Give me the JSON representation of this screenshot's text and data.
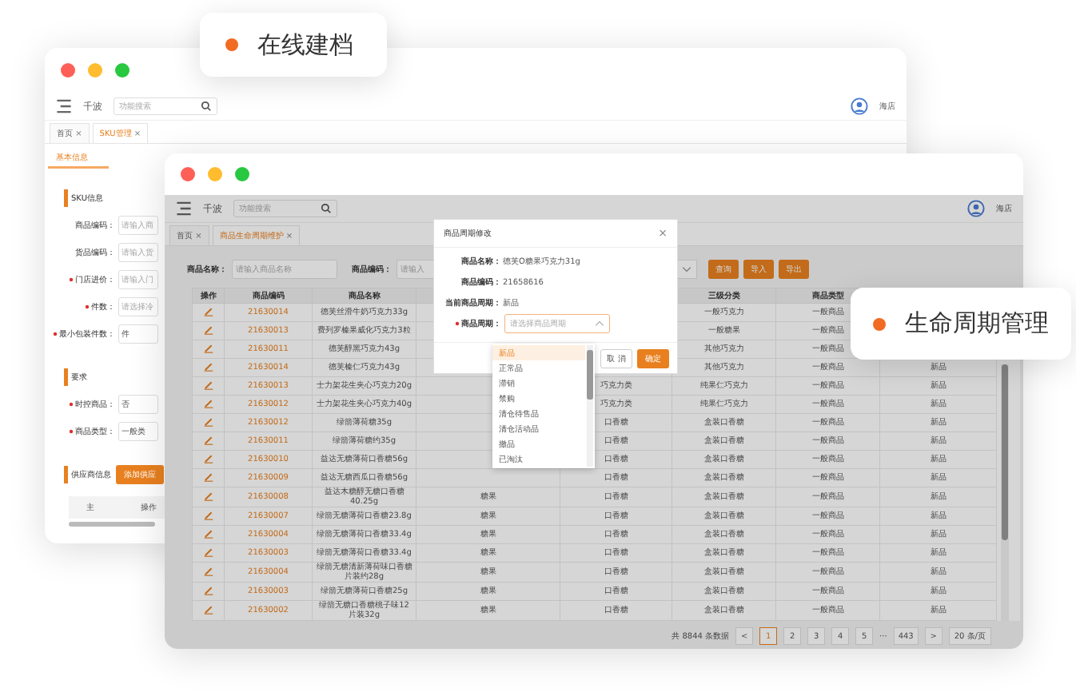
{
  "callouts": [
    {
      "text": "在线建档"
    },
    {
      "text": "生命周期管理"
    }
  ],
  "back_window": {
    "brand": "千波",
    "search_placeholder": "功能搜索",
    "user": "海店",
    "tabs": [
      {
        "label": "首页",
        "close": "×",
        "selected": false
      },
      {
        "label": "SKU管理",
        "close": "×",
        "selected": true
      }
    ],
    "subtab": "基本信息",
    "sections": [
      {
        "title": "SKU信息",
        "fields": [
          {
            "label": "商品编码：",
            "required": false,
            "placeholder": "请输入商"
          },
          {
            "label": "货品编码：",
            "required": false,
            "placeholder": "请输入货"
          },
          {
            "label": "门店进价：",
            "required": true,
            "placeholder": "请输入门"
          },
          {
            "label": "件数：",
            "required": true,
            "placeholder": "请选择冷"
          },
          {
            "label": "最小包装件数：",
            "required": true,
            "value": "件"
          }
        ]
      },
      {
        "title": "要求",
        "fields": [
          {
            "label": "时控商品：",
            "required": true,
            "value": "否"
          },
          {
            "label": "商品类型：",
            "required": true,
            "value": "一般类"
          }
        ]
      }
    ],
    "supplier": {
      "title": "供应商信息",
      "button": "添加供应",
      "columns": [
        "主",
        "操作"
      ]
    }
  },
  "front_window": {
    "brand": "千波",
    "search_placeholder": "功能搜索",
    "user": "海店",
    "tabs": [
      {
        "label": "首页",
        "close": "×",
        "selected": false
      },
      {
        "label": "商品生命周期维护",
        "close": "×",
        "selected": true
      }
    ],
    "filters": [
      {
        "label": "商品名称：",
        "placeholder": "请输入商品名称"
      },
      {
        "label": "商品编码：",
        "placeholder": "请输入"
      }
    ],
    "buttons": [
      "查询",
      "导入",
      "导出"
    ],
    "columns": [
      "操作",
      "商品编码",
      "商品名称",
      "三级分类",
      "商品类型"
    ],
    "rows": [
      {
        "code": "21630014",
        "name": "德芙丝滑牛奶巧克力33g",
        "cat3": "一般巧克力",
        "type": "一般商品"
      },
      {
        "code": "21630013",
        "name": "费列罗榛果威化巧克力3粒",
        "cat3": "一般糖果",
        "type": "一般商品"
      },
      {
        "code": "21630011",
        "name": "德芙醇黑巧克力43g",
        "cat3": "其他巧克力",
        "type": "一般商品"
      },
      {
        "code": "21630014",
        "name": "德芙榛仁巧克力43g",
        "cat3": "其他巧克力",
        "type": "一般商品",
        "cycle": "新品"
      },
      {
        "code": "21630013",
        "name": "士力架花生夹心巧克力20g",
        "cat3": "纯果仁巧克力",
        "type": "一般商品",
        "cat2": "巧克力类",
        "cycle": "新品"
      },
      {
        "code": "21630012",
        "name": "士力架花生夹心巧克力40g",
        "cat3": "纯果仁巧克力",
        "type": "一般商品",
        "cat2": "巧克力类",
        "cycle": "新品"
      },
      {
        "code": "21630012",
        "name": "绿箭薄荷糖35g",
        "cat3": "盒装口香糖",
        "type": "一般商品",
        "cat2": "口香糖",
        "cycle": "新品"
      },
      {
        "code": "21630011",
        "name": "绿箭薄荷糖约35g",
        "cat3": "盒装口香糖",
        "type": "一般商品",
        "cat2": "口香糖",
        "cycle": "新品"
      },
      {
        "code": "21630010",
        "name": "益达无糖薄荷口香糖56g",
        "cat3": "盒装口香糖",
        "type": "一般商品",
        "cat2": "口香糖",
        "cycle": "新品"
      },
      {
        "code": "21630009",
        "name": "益达无糖西瓜口香糖56g",
        "cat3": "盒装口香糖",
        "type": "一般商品",
        "cat2": "口香糖",
        "cycle": "新品"
      },
      {
        "code": "21630008",
        "name": "益达木糖醇无糖口香糖40.25g",
        "cat3": "盒装口香糖",
        "type": "一般商品",
        "cat1": "糖果",
        "cat2": "口香糖",
        "cycle": "新品"
      },
      {
        "code": "21630007",
        "name": "绿箭无糖薄荷口香糖23.8g",
        "cat3": "盒装口香糖",
        "type": "一般商品",
        "cat1": "糖果",
        "cat2": "口香糖",
        "cycle": "新品"
      },
      {
        "code": "21630004",
        "name": "绿箭无糖薄荷口香糖33.4g",
        "cat3": "盒装口香糖",
        "type": "一般商品",
        "cat1": "糖果",
        "cat2": "口香糖",
        "cycle": "新品"
      },
      {
        "code": "21630003",
        "name": "绿箭无糖薄荷口香糖33.4g",
        "cat3": "盒装口香糖",
        "type": "一般商品",
        "cat1": "糖果",
        "cat2": "口香糖",
        "cycle": "新品"
      },
      {
        "code": "21630004",
        "name": "绿箭无糖清新薄荷味口香糖片装约28g",
        "cat3": "盒装口香糖",
        "type": "一般商品",
        "cat1": "糖果",
        "cat2": "口香糖",
        "cycle": "新品"
      },
      {
        "code": "21630003",
        "name": "绿箭无糖薄荷口香糖25g",
        "cat3": "盒装口香糖",
        "type": "一般商品",
        "cat1": "糖果",
        "cat2": "口香糖",
        "cycle": "新品"
      },
      {
        "code": "21630002",
        "name": "绿箭无糖口香糖桃子味12片装32g",
        "cat3": "盒装口香糖",
        "type": "一般商品",
        "cat1": "糖果",
        "cat2": "口香糖",
        "cycle": "新品"
      }
    ],
    "pagination": {
      "total": "共 8844 条数据",
      "prev": "<",
      "pages": [
        {
          "label": "1",
          "selected": true
        },
        {
          "label": "2",
          "selected": false
        },
        {
          "label": "3",
          "selected": false
        },
        {
          "label": "4",
          "selected": false
        },
        {
          "label": "5",
          "selected": false
        }
      ],
      "ellipsis": "···",
      "last": "443",
      "next": ">",
      "page_size": "20 条/页"
    },
    "dialog": {
      "title": "商品周期修改",
      "close": "×",
      "info": [
        {
          "label": "商品名称：",
          "value": "德芙O糖果巧克力31g"
        },
        {
          "label": "商品编码：",
          "value": "21658616"
        },
        {
          "label": "当前商品周期：",
          "value": "新品"
        }
      ],
      "select": {
        "label": "商品周期：",
        "required": true,
        "placeholder": "请选择商品周期"
      },
      "cancel": "取 消",
      "confirm": "确定",
      "options": [
        {
          "label": "新品",
          "selected": true
        },
        {
          "label": "正常品",
          "selected": false
        },
        {
          "label": "滞销",
          "selected": false
        },
        {
          "label": "禁购",
          "selected": false
        },
        {
          "label": "清仓待售品",
          "selected": false
        },
        {
          "label": "清仓活动品",
          "selected": false
        },
        {
          "label": "撤品",
          "selected": false
        },
        {
          "label": "已淘汰",
          "selected": false
        }
      ]
    }
  }
}
